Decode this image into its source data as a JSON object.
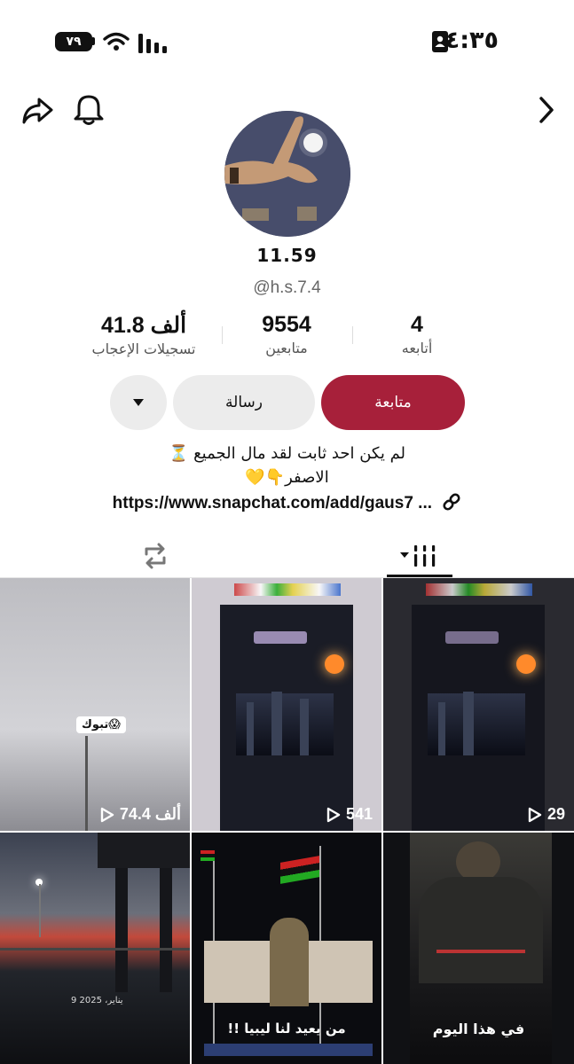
{
  "status_bar": {
    "battery": "٧٩",
    "time": "٤:٣٥"
  },
  "profile": {
    "display_name": "11.59",
    "username": "@h.s.7.4",
    "stats": [
      {
        "value": "4",
        "label": "أتابعه"
      },
      {
        "value": "9554",
        "label": "متابعين"
      },
      {
        "value": "41.8 ألف",
        "label": "تسجيلات الإعجاب"
      }
    ],
    "follow_label": "متابعة",
    "message_label": "رسالة",
    "bio_line1": "لم يكن احد ثابت لقد مال الجميع ⏳",
    "bio_line2": "الاصفر👇💛",
    "link": "https://www.snapchat.com/add/gaus7 ..."
  },
  "videos": [
    {
      "views": "74.4 ألف",
      "caption": "تبوك😱"
    },
    {
      "views": "541",
      "caption": ""
    },
    {
      "views": "29",
      "caption": ""
    },
    {
      "views": "",
      "caption": "9 يناير، 2025"
    },
    {
      "views": "",
      "caption": "من يعيد لنا ليبيا !!"
    },
    {
      "views": "",
      "caption": "في هذا اليوم"
    }
  ],
  "icons": {
    "battery": "battery-icon",
    "wifi": "wifi-icon",
    "signal": "signal-icon",
    "id": "contact-card-icon",
    "share": "share-icon",
    "bell": "bell-icon",
    "back": "chevron-right-icon",
    "reposts": "repost-icon",
    "videos": "video-grid-icon",
    "link": "link-icon",
    "play": "play-icon"
  }
}
